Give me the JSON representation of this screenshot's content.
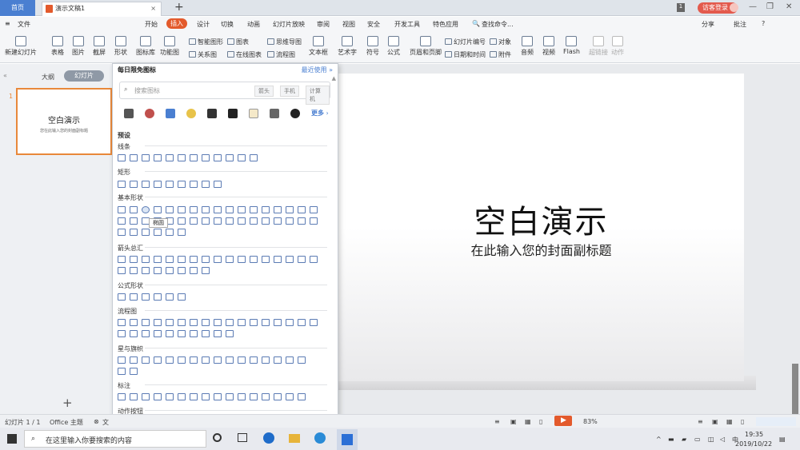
{
  "tabs": {
    "home": "首页",
    "doc": "演示文稿1",
    "new": "+"
  },
  "window": {
    "page": "1",
    "login": "访客登录"
  },
  "menu": {
    "file": "文件",
    "items": [
      "开始",
      "插入",
      "设计",
      "切换",
      "动画",
      "幻灯片放映",
      "审阅",
      "视图",
      "安全",
      "开发工具",
      "特色应用"
    ],
    "search": "查找命令...",
    "share": "分享",
    "comment": "批注"
  },
  "ribbon": {
    "new_slide": "新建幻灯片",
    "table": "表格",
    "picture": "图片",
    "screenshot": "截屏",
    "shape": "形状",
    "icon_lib": "图标库",
    "func_chart": "功能图",
    "smart_art": "智能图形",
    "chart": "图表",
    "mindmap": "思维导图",
    "relation": "关系图",
    "online_chart": "在线图表",
    "flow": "流程图",
    "textbox": "文本框",
    "wordart": "艺术字",
    "symbol": "符号",
    "formula": "公式",
    "header_footer": "页眉和页脚",
    "slide_num": "幻灯片编号",
    "object": "对象",
    "datetime": "日期和时间",
    "attach": "附件",
    "audio": "音频",
    "video": "视频",
    "flash": "Flash",
    "hyperlink": "超链接",
    "action": "动作"
  },
  "left": {
    "outline": "大纲",
    "slides": "幻灯片",
    "num": "1",
    "thumb_title": "空白演示",
    "thumb_sub": "您在此输入您的封面副标题",
    "add": "+"
  },
  "panel": {
    "header": "每日限免图标",
    "recent": "最近使用",
    "search_ph": "搜索图标",
    "tags": [
      "箭头",
      "手机",
      "计算机"
    ],
    "more": "更多",
    "preset": "预设",
    "sections": [
      "线条",
      "矩形",
      "基本形状",
      "箭头总汇",
      "公式形状",
      "流程图",
      "星与旗帜",
      "标注",
      "动作按钮"
    ],
    "tooltip": "椭圆"
  },
  "slide": {
    "title": "空白演示",
    "subtitle": "在此输入您的封面副标题"
  },
  "status": {
    "slide_count": "幻灯片 1 / 1",
    "theme": "Office 主题",
    "doc": "文",
    "zoom": "83%"
  },
  "taskbar": {
    "search": "在这里输入你要搜索的内容",
    "time": "19:35",
    "date": "2019/10/22",
    "ime": "中"
  },
  "colors": {
    "accent": "#e35a2c",
    "blue": "#4a7fd1"
  }
}
